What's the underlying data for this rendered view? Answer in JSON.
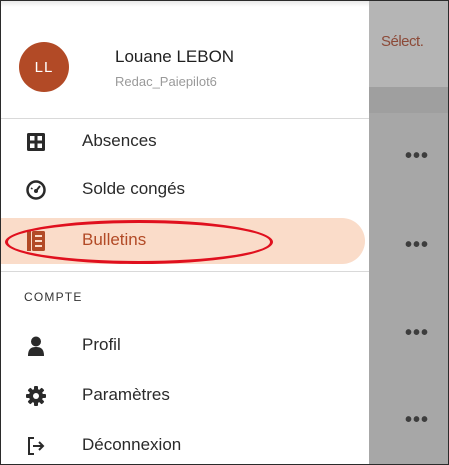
{
  "background": {
    "select_label": "Sélect.",
    "more_label": "•••"
  },
  "user": {
    "initials": "LL",
    "name": "Louane LEBON",
    "id": "Redac_Paiepilot6"
  },
  "menu": {
    "items": [
      {
        "label": "Absences",
        "icon": "grid-icon"
      },
      {
        "label": "Solde congés",
        "icon": "gauge-icon"
      },
      {
        "label": "Bulletins",
        "icon": "document-icon",
        "active": true
      }
    ],
    "section_title": "COMPTE",
    "account_items": [
      {
        "label": "Profil",
        "icon": "person-icon"
      },
      {
        "label": "Paramètres",
        "icon": "gear-icon"
      },
      {
        "label": "Déconnexion",
        "icon": "logout-icon"
      }
    ]
  },
  "colors": {
    "accent": "#b24a26",
    "active_bg": "#fadcc9",
    "annotation": "#e0101e"
  }
}
